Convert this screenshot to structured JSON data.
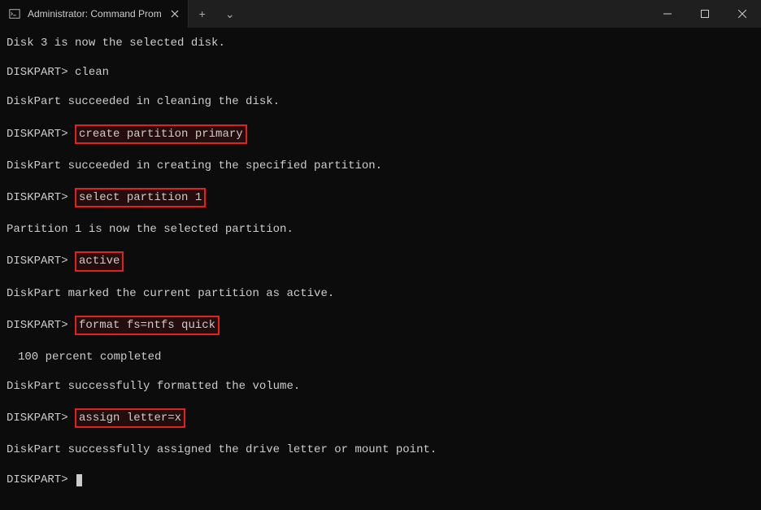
{
  "titlebar": {
    "tab_title": "Administrator: Command Prom",
    "new_tab_label": "+",
    "dropdown_label": "⌄"
  },
  "terminal": {
    "prompt": "DISKPART>",
    "lines": {
      "disk_selected": "Disk 3 is now the selected disk.",
      "clean_cmd": " clean",
      "clean_result": "DiskPart succeeded in cleaning the disk.",
      "create_cmd": "create partition primary",
      "create_result": "DiskPart succeeded in creating the specified partition.",
      "select_cmd": "select partition 1",
      "select_result": "Partition 1 is now the selected partition.",
      "active_cmd": "active",
      "active_result": "DiskPart marked the current partition as active.",
      "format_cmd": "format fs=ntfs quick",
      "format_progress": "100 percent completed",
      "format_result": "DiskPart successfully formatted the volume.",
      "assign_cmd": "assign letter=x",
      "assign_result": "DiskPart successfully assigned the drive letter or mount point."
    }
  }
}
